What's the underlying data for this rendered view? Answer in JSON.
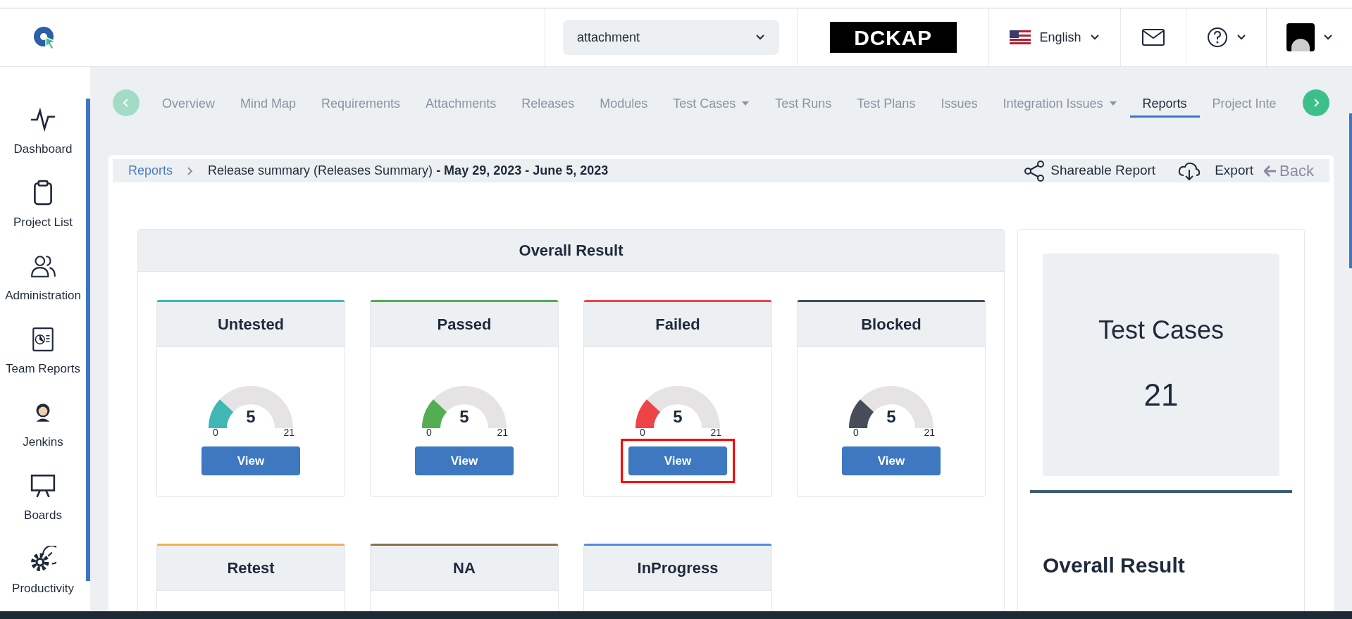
{
  "header": {
    "project_select": {
      "value": "attachment"
    },
    "brand_logo_text": "DCKAP",
    "language": "English"
  },
  "sidebar": {
    "items": [
      {
        "label": "Dashboard",
        "kind": "pulse"
      },
      {
        "label": "Project List",
        "kind": "clipboard"
      },
      {
        "label": "Administration",
        "kind": "users"
      },
      {
        "label": "Team Reports",
        "kind": "report"
      },
      {
        "label": "Jenkins",
        "kind": "person"
      },
      {
        "label": "Boards",
        "kind": "board"
      },
      {
        "label": "Productivity",
        "kind": "gear"
      }
    ]
  },
  "tabs": [
    {
      "label": "Overview",
      "selected": false,
      "dropdown": false
    },
    {
      "label": "Mind Map",
      "selected": false,
      "dropdown": false
    },
    {
      "label": "Requirements",
      "selected": false,
      "dropdown": false
    },
    {
      "label": "Attachments",
      "selected": false,
      "dropdown": false
    },
    {
      "label": "Releases",
      "selected": false,
      "dropdown": false
    },
    {
      "label": "Modules",
      "selected": false,
      "dropdown": false
    },
    {
      "label": "Test Cases",
      "selected": false,
      "dropdown": true
    },
    {
      "label": "Test Runs",
      "selected": false,
      "dropdown": false
    },
    {
      "label": "Test Plans",
      "selected": false,
      "dropdown": false
    },
    {
      "label": "Issues",
      "selected": false,
      "dropdown": false
    },
    {
      "label": "Integration Issues",
      "selected": false,
      "dropdown": true
    },
    {
      "label": "Reports",
      "selected": true,
      "dropdown": false
    },
    {
      "label": "Project Inte",
      "selected": false,
      "dropdown": false
    }
  ],
  "breadcrumb": {
    "link": "Reports",
    "title": "Release summary (Releases Summary) **- May 29, 2023 - June 5, 2023**"
  },
  "actions": {
    "share": "Shareable Report",
    "export": "Export",
    "back": "Back"
  },
  "overall_result": {
    "title": "Overall Result",
    "cards": [
      {
        "title": "Untested",
        "color": "#3fb8b5",
        "level": 0.238,
        "value": "5",
        "min": "0",
        "max": "21",
        "button": "View",
        "highlighted": false
      },
      {
        "title": "Passed",
        "color": "#53ad51",
        "level": 0.238,
        "value": "5",
        "min": "0",
        "max": "21",
        "button": "View",
        "highlighted": false
      },
      {
        "title": "Failed",
        "color": "#ee4448",
        "level": 0.238,
        "value": "5",
        "min": "0",
        "max": "21",
        "button": "View",
        "highlighted": true
      },
      {
        "title": "Blocked",
        "color": "#474c59",
        "level": 0.238,
        "value": "5",
        "min": "0",
        "max": "21",
        "button": "View",
        "highlighted": false
      },
      {
        "title": "Retest",
        "color": "#f6ad55"
      },
      {
        "title": "NA",
        "color": "#8b6f47"
      },
      {
        "title": "InProgress",
        "color": "#4a8ee6"
      }
    ]
  },
  "summary": {
    "label": "Test Cases",
    "count": "21",
    "section_title": "Overall Result"
  }
}
